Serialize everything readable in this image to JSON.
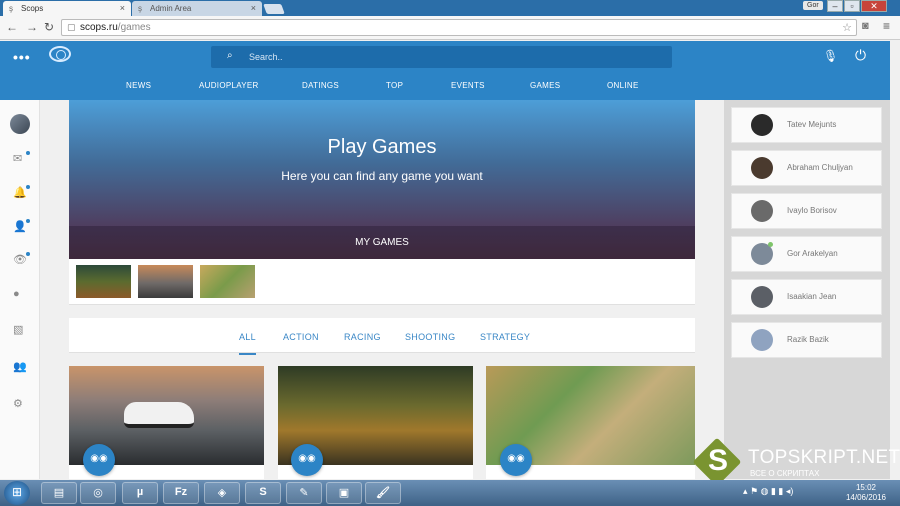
{
  "browser": {
    "tabs": [
      {
        "label": "Scops",
        "active": true
      },
      {
        "label": "Admin Area",
        "active": false
      }
    ],
    "window_user": "Gor",
    "url_host": "scops.ru",
    "url_path": "/games"
  },
  "site": {
    "search_placeholder": "Search..",
    "nav": [
      "NEWS",
      "AUDIOPLAYER",
      "DATINGS",
      "TOP",
      "EVENTS",
      "GAMES",
      "ONLINE"
    ],
    "brand_color": "#2c84c6"
  },
  "hero": {
    "title": "Play Games",
    "subtitle": "Here you can find any game you want",
    "my_games": "MY GAMES"
  },
  "filters": {
    "tabs": [
      "ALL",
      "ACTION",
      "RACING",
      "SHOOTING",
      "STRATEGY"
    ],
    "active": "ALL"
  },
  "online_users": [
    {
      "name": "Tatev Mejunts"
    },
    {
      "name": "Abraham Chuljyan"
    },
    {
      "name": "Ivaylo Borisov"
    },
    {
      "name": "Gor Arakelyan"
    },
    {
      "name": "Isaakian Jean"
    },
    {
      "name": "Razik Bazik"
    }
  ],
  "watermark": {
    "letter": "S",
    "title": "TOPSKRIPT.NET",
    "subtitle": "ВСЕ О СКРИПТАХ"
  },
  "taskbar": {
    "time": "15:02",
    "date": "14/06/2016",
    "apps": [
      "folder",
      "chrome",
      "utorrent",
      "filezilla",
      "hotspot",
      "skype",
      "notepad",
      "network",
      "paint"
    ]
  }
}
